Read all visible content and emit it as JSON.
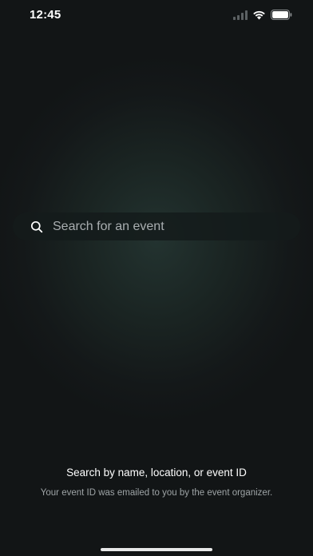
{
  "status_bar": {
    "time": "12:45",
    "icons": [
      "signal-icon",
      "wifi-icon",
      "battery-icon"
    ]
  },
  "search": {
    "placeholder": "Search for an event",
    "value": "",
    "icon": "search-icon"
  },
  "hint": {
    "title": "Search by name, location, or event ID",
    "subtitle": "Your event ID was emailed to you by the event organizer."
  },
  "colors": {
    "background": "#121516",
    "glow": "#233330",
    "placeholder": "#a9aeb0",
    "subtitle": "#9ea4a6"
  }
}
